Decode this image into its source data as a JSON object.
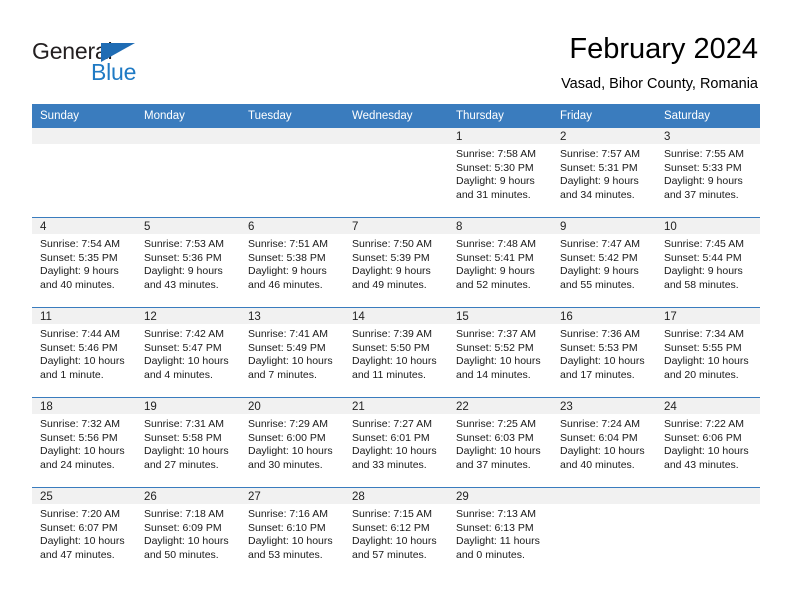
{
  "logo": {
    "word_one": "General",
    "word_two": "Blue",
    "triangle_color": "#1f6cb4",
    "blue_color": "#1f7ac4"
  },
  "header": {
    "title": "February 2024",
    "subtitle": "Vasad, Bihor County, Romania",
    "header_bg": "#3a7cbe",
    "daynum_bg": "#f1f1f1"
  },
  "weekday_headers": [
    "Sunday",
    "Monday",
    "Tuesday",
    "Wednesday",
    "Thursday",
    "Friday",
    "Saturday"
  ],
  "weeks": [
    [
      {
        "day": "",
        "sunrise": "",
        "sunset": "",
        "daylight1": "",
        "daylight2": ""
      },
      {
        "day": "",
        "sunrise": "",
        "sunset": "",
        "daylight1": "",
        "daylight2": ""
      },
      {
        "day": "",
        "sunrise": "",
        "sunset": "",
        "daylight1": "",
        "daylight2": ""
      },
      {
        "day": "",
        "sunrise": "",
        "sunset": "",
        "daylight1": "",
        "daylight2": ""
      },
      {
        "day": "1",
        "sunrise": "Sunrise: 7:58 AM",
        "sunset": "Sunset: 5:30 PM",
        "daylight1": "Daylight: 9 hours",
        "daylight2": "and 31 minutes."
      },
      {
        "day": "2",
        "sunrise": "Sunrise: 7:57 AM",
        "sunset": "Sunset: 5:31 PM",
        "daylight1": "Daylight: 9 hours",
        "daylight2": "and 34 minutes."
      },
      {
        "day": "3",
        "sunrise": "Sunrise: 7:55 AM",
        "sunset": "Sunset: 5:33 PM",
        "daylight1": "Daylight: 9 hours",
        "daylight2": "and 37 minutes."
      }
    ],
    [
      {
        "day": "4",
        "sunrise": "Sunrise: 7:54 AM",
        "sunset": "Sunset: 5:35 PM",
        "daylight1": "Daylight: 9 hours",
        "daylight2": "and 40 minutes."
      },
      {
        "day": "5",
        "sunrise": "Sunrise: 7:53 AM",
        "sunset": "Sunset: 5:36 PM",
        "daylight1": "Daylight: 9 hours",
        "daylight2": "and 43 minutes."
      },
      {
        "day": "6",
        "sunrise": "Sunrise: 7:51 AM",
        "sunset": "Sunset: 5:38 PM",
        "daylight1": "Daylight: 9 hours",
        "daylight2": "and 46 minutes."
      },
      {
        "day": "7",
        "sunrise": "Sunrise: 7:50 AM",
        "sunset": "Sunset: 5:39 PM",
        "daylight1": "Daylight: 9 hours",
        "daylight2": "and 49 minutes."
      },
      {
        "day": "8",
        "sunrise": "Sunrise: 7:48 AM",
        "sunset": "Sunset: 5:41 PM",
        "daylight1": "Daylight: 9 hours",
        "daylight2": "and 52 minutes."
      },
      {
        "day": "9",
        "sunrise": "Sunrise: 7:47 AM",
        "sunset": "Sunset: 5:42 PM",
        "daylight1": "Daylight: 9 hours",
        "daylight2": "and 55 minutes."
      },
      {
        "day": "10",
        "sunrise": "Sunrise: 7:45 AM",
        "sunset": "Sunset: 5:44 PM",
        "daylight1": "Daylight: 9 hours",
        "daylight2": "and 58 minutes."
      }
    ],
    [
      {
        "day": "11",
        "sunrise": "Sunrise: 7:44 AM",
        "sunset": "Sunset: 5:46 PM",
        "daylight1": "Daylight: 10 hours",
        "daylight2": "and 1 minute."
      },
      {
        "day": "12",
        "sunrise": "Sunrise: 7:42 AM",
        "sunset": "Sunset: 5:47 PM",
        "daylight1": "Daylight: 10 hours",
        "daylight2": "and 4 minutes."
      },
      {
        "day": "13",
        "sunrise": "Sunrise: 7:41 AM",
        "sunset": "Sunset: 5:49 PM",
        "daylight1": "Daylight: 10 hours",
        "daylight2": "and 7 minutes."
      },
      {
        "day": "14",
        "sunrise": "Sunrise: 7:39 AM",
        "sunset": "Sunset: 5:50 PM",
        "daylight1": "Daylight: 10 hours",
        "daylight2": "and 11 minutes."
      },
      {
        "day": "15",
        "sunrise": "Sunrise: 7:37 AM",
        "sunset": "Sunset: 5:52 PM",
        "daylight1": "Daylight: 10 hours",
        "daylight2": "and 14 minutes."
      },
      {
        "day": "16",
        "sunrise": "Sunrise: 7:36 AM",
        "sunset": "Sunset: 5:53 PM",
        "daylight1": "Daylight: 10 hours",
        "daylight2": "and 17 minutes."
      },
      {
        "day": "17",
        "sunrise": "Sunrise: 7:34 AM",
        "sunset": "Sunset: 5:55 PM",
        "daylight1": "Daylight: 10 hours",
        "daylight2": "and 20 minutes."
      }
    ],
    [
      {
        "day": "18",
        "sunrise": "Sunrise: 7:32 AM",
        "sunset": "Sunset: 5:56 PM",
        "daylight1": "Daylight: 10 hours",
        "daylight2": "and 24 minutes."
      },
      {
        "day": "19",
        "sunrise": "Sunrise: 7:31 AM",
        "sunset": "Sunset: 5:58 PM",
        "daylight1": "Daylight: 10 hours",
        "daylight2": "and 27 minutes."
      },
      {
        "day": "20",
        "sunrise": "Sunrise: 7:29 AM",
        "sunset": "Sunset: 6:00 PM",
        "daylight1": "Daylight: 10 hours",
        "daylight2": "and 30 minutes."
      },
      {
        "day": "21",
        "sunrise": "Sunrise: 7:27 AM",
        "sunset": "Sunset: 6:01 PM",
        "daylight1": "Daylight: 10 hours",
        "daylight2": "and 33 minutes."
      },
      {
        "day": "22",
        "sunrise": "Sunrise: 7:25 AM",
        "sunset": "Sunset: 6:03 PM",
        "daylight1": "Daylight: 10 hours",
        "daylight2": "and 37 minutes."
      },
      {
        "day": "23",
        "sunrise": "Sunrise: 7:24 AM",
        "sunset": "Sunset: 6:04 PM",
        "daylight1": "Daylight: 10 hours",
        "daylight2": "and 40 minutes."
      },
      {
        "day": "24",
        "sunrise": "Sunrise: 7:22 AM",
        "sunset": "Sunset: 6:06 PM",
        "daylight1": "Daylight: 10 hours",
        "daylight2": "and 43 minutes."
      }
    ],
    [
      {
        "day": "25",
        "sunrise": "Sunrise: 7:20 AM",
        "sunset": "Sunset: 6:07 PM",
        "daylight1": "Daylight: 10 hours",
        "daylight2": "and 47 minutes."
      },
      {
        "day": "26",
        "sunrise": "Sunrise: 7:18 AM",
        "sunset": "Sunset: 6:09 PM",
        "daylight1": "Daylight: 10 hours",
        "daylight2": "and 50 minutes."
      },
      {
        "day": "27",
        "sunrise": "Sunrise: 7:16 AM",
        "sunset": "Sunset: 6:10 PM",
        "daylight1": "Daylight: 10 hours",
        "daylight2": "and 53 minutes."
      },
      {
        "day": "28",
        "sunrise": "Sunrise: 7:15 AM",
        "sunset": "Sunset: 6:12 PM",
        "daylight1": "Daylight: 10 hours",
        "daylight2": "and 57 minutes."
      },
      {
        "day": "29",
        "sunrise": "Sunrise: 7:13 AM",
        "sunset": "Sunset: 6:13 PM",
        "daylight1": "Daylight: 11 hours",
        "daylight2": "and 0 minutes."
      },
      {
        "day": "",
        "sunrise": "",
        "sunset": "",
        "daylight1": "",
        "daylight2": ""
      },
      {
        "day": "",
        "sunrise": "",
        "sunset": "",
        "daylight1": "",
        "daylight2": ""
      }
    ]
  ]
}
